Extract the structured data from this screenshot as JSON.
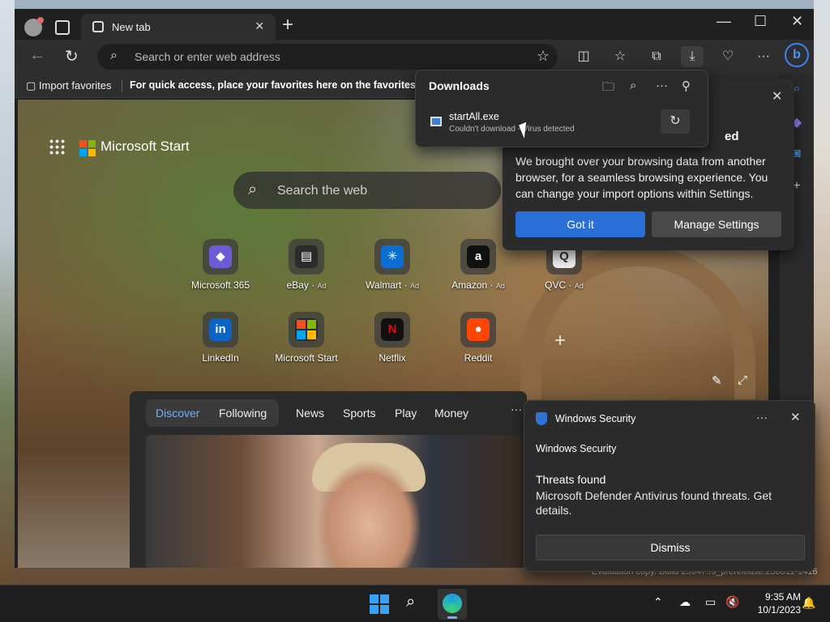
{
  "browser": {
    "tab_title": "New tab",
    "address_placeholder": "Search or enter web address",
    "window_controls": {
      "minimize": "—",
      "maximize": "☐",
      "close": "✕"
    }
  },
  "favorites_bar": {
    "import_label": "Import favorites",
    "message": "For quick access, place your favorites here on the favorites bar.",
    "link_fragment": "M"
  },
  "new_tab_page": {
    "brand": "Microsoft Start",
    "search_placeholder": "Search the web",
    "quick_links": [
      {
        "label": "Microsoft 365",
        "ad": "",
        "glyph": "◆",
        "color": "#6a5cd6"
      },
      {
        "label": "eBay",
        "ad": "Ad",
        "glyph": "▤",
        "color": "#2b2b2b"
      },
      {
        "label": "Walmart",
        "ad": "Ad",
        "glyph": "✳",
        "color": "#0a6fd1"
      },
      {
        "label": "Amazon",
        "ad": "Ad",
        "glyph": "a",
        "color": "#111111"
      },
      {
        "label": "QVC",
        "ad": "Ad",
        "glyph": "Q",
        "color": "#f2f2f2"
      },
      {
        "label": "LinkedIn",
        "ad": "",
        "glyph": "in",
        "color": "#0a66c2"
      },
      {
        "label": "Microsoft Start",
        "ad": "",
        "glyph": "",
        "color": "#2b2b2b"
      },
      {
        "label": "Netflix",
        "ad": "",
        "glyph": "N",
        "color": "#111111"
      },
      {
        "label": "Reddit",
        "ad": "",
        "glyph": "●",
        "color": "#ff4500"
      }
    ],
    "feed": {
      "pivots": [
        "Discover",
        "Following"
      ],
      "tabs": [
        "News",
        "Sports",
        "Play",
        "Money"
      ],
      "more": "···"
    }
  },
  "downloads_panel": {
    "title": "Downloads",
    "item": {
      "filename": "startAll.exe",
      "status": "Couldn't download - Virus detected"
    }
  },
  "import_popup": {
    "title_fragment": "ed",
    "body": "We brought over your browsing data from another browser, for a seamless browsing experience. You can change your import options within Settings.",
    "primary_button": "Got it",
    "secondary_button": "Manage Settings"
  },
  "toast": {
    "app": "Windows Security",
    "subtitle": "Windows Security",
    "heading": "Threats found",
    "body": "Microsoft Defender Antivirus found threats. Get details.",
    "button": "Dismiss",
    "more": "···"
  },
  "desktop": {
    "watermark": "Evaluation copy. Build 25947.rs_prerelease.230811-1416"
  },
  "taskbar": {
    "time": "9:35 AM",
    "date": "10/1/2023"
  }
}
